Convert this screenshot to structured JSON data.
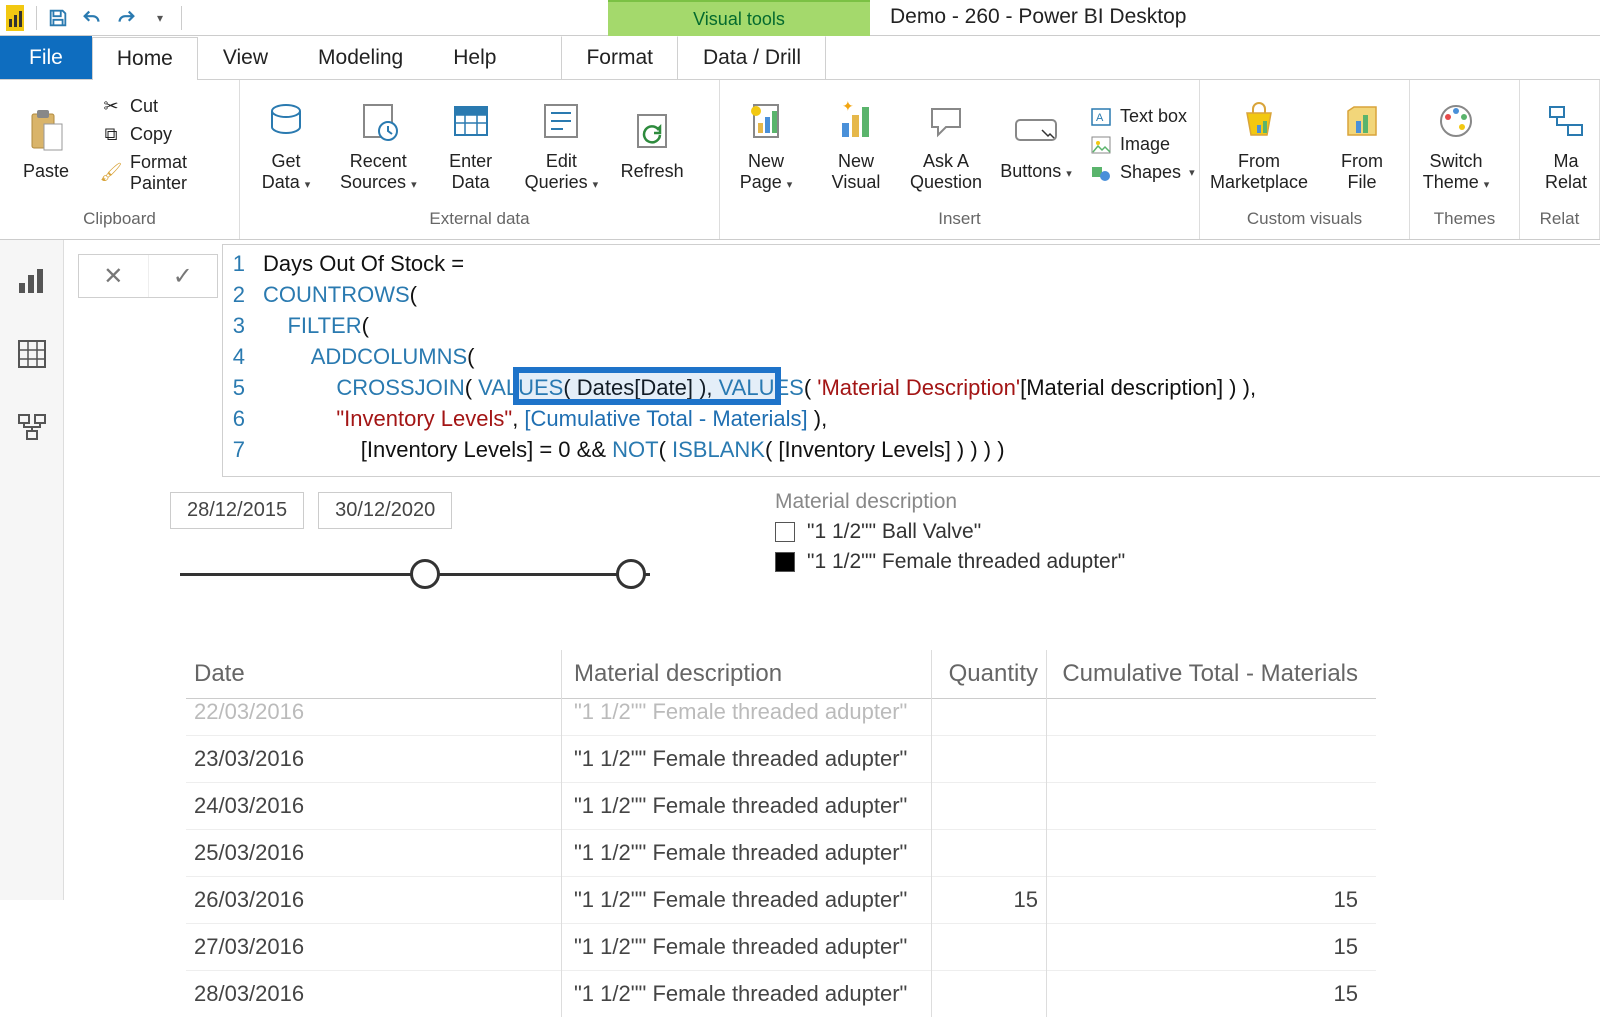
{
  "window": {
    "title": "Demo - 260 - Power BI Desktop",
    "contextual_tab": "Visual tools"
  },
  "qat": {
    "save": "💾",
    "undo": "↶",
    "redo": "↷"
  },
  "tabs": {
    "file": "File",
    "home": "Home",
    "view": "View",
    "modeling": "Modeling",
    "help": "Help",
    "format": "Format",
    "data_drill": "Data / Drill"
  },
  "ribbon": {
    "clipboard": {
      "label": "Clipboard",
      "paste": "Paste",
      "cut": "Cut",
      "copy": "Copy",
      "format_painter": "Format Painter"
    },
    "external": {
      "label": "External data",
      "get_data": "Get\nData",
      "recent_sources": "Recent\nSources",
      "enter_data": "Enter\nData",
      "edit_queries": "Edit\nQueries",
      "refresh": "Refresh"
    },
    "insert": {
      "label": "Insert",
      "new_page": "New\nPage",
      "new_visual": "New\nVisual",
      "ask_question": "Ask A\nQuestion",
      "buttons": "Buttons",
      "text_box": "Text box",
      "image": "Image",
      "shapes": "Shapes"
    },
    "custom": {
      "label": "Custom visuals",
      "marketplace": "From\nMarketplace",
      "from_file": "From\nFile"
    },
    "themes": {
      "label": "Themes",
      "switch_theme": "Switch\nTheme"
    },
    "relationships": {
      "label": "Relat",
      "manage": "Ma\nRelat"
    }
  },
  "formula": {
    "lines": [
      "Days Out Of Stock =",
      "COUNTROWS(",
      "    FILTER(",
      "        ADDCOLUMNS(",
      "            CROSSJOIN( VALUES( Dates[Date] ), VALUES( 'Material Description'[Material description] ) ),",
      "            \"Inventory Levels\", [Cumulative Total - Materials] ),",
      "                [Inventory Levels] = 0 && NOT( ISBLANK( [Inventory Levels] ) ) ) )"
    ]
  },
  "slicer": {
    "from": "28/12/2015",
    "to": "30/12/2020"
  },
  "legend": {
    "header": "Material description",
    "items": [
      {
        "label": "\"1 1/2\"\" Ball Valve\"",
        "checked": false
      },
      {
        "label": "\"1 1/2\"\" Female threaded adupter\"",
        "checked": true
      }
    ]
  },
  "table": {
    "headers": {
      "date": "Date",
      "material": "Material description",
      "qty": "Quantity",
      "cum": "Cumulative Total - Materials"
    },
    "rows": [
      {
        "date": "22/03/2016",
        "material": "\"1 1/2\"\" Female threaded adupter\"",
        "qty": "",
        "cum": ""
      },
      {
        "date": "23/03/2016",
        "material": "\"1 1/2\"\" Female threaded adupter\"",
        "qty": "",
        "cum": ""
      },
      {
        "date": "24/03/2016",
        "material": "\"1 1/2\"\" Female threaded adupter\"",
        "qty": "",
        "cum": ""
      },
      {
        "date": "25/03/2016",
        "material": "\"1 1/2\"\" Female threaded adupter\"",
        "qty": "",
        "cum": ""
      },
      {
        "date": "26/03/2016",
        "material": "\"1 1/2\"\" Female threaded adupter\"",
        "qty": "15",
        "cum": "15"
      },
      {
        "date": "27/03/2016",
        "material": "\"1 1/2\"\" Female threaded adupter\"",
        "qty": "",
        "cum": "15"
      },
      {
        "date": "28/03/2016",
        "material": "\"1 1/2\"\" Female threaded adupter\"",
        "qty": "",
        "cum": "15"
      }
    ]
  }
}
